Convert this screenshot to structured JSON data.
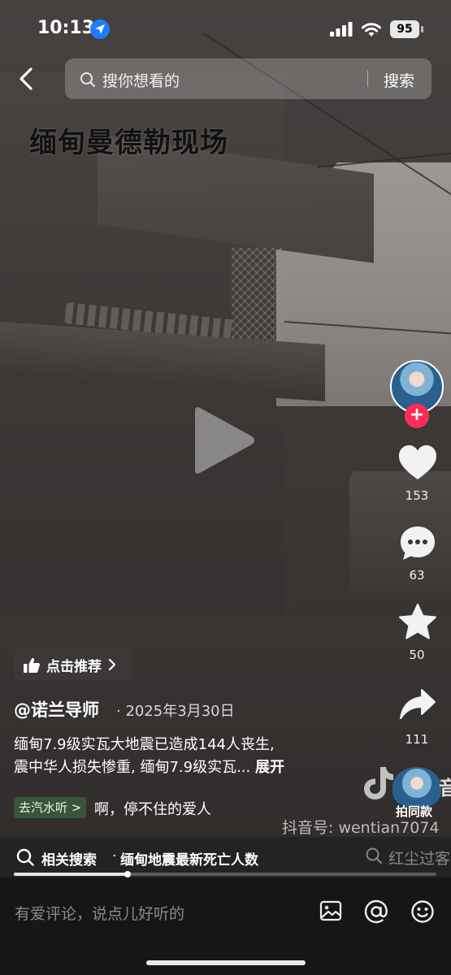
{
  "status_bar": {
    "time": "10:13",
    "battery": "95",
    "icons": [
      "location-icon",
      "signal-icon",
      "wifi-icon",
      "battery-icon"
    ]
  },
  "search": {
    "placeholder": "搜你想看的",
    "button_label": "搜索"
  },
  "video": {
    "overlay_title": "缅甸曼德勒现场",
    "state": "paused"
  },
  "actions": {
    "likes": "153",
    "comments": "63",
    "favorites": "50",
    "shares": "111"
  },
  "info": {
    "recommend_label": "点击推荐",
    "author": "@诺兰导师",
    "date": "· 2025年3月30日",
    "description_line1": "缅甸7.9级实瓦大地震已造成144人丧生,",
    "description_line2": "震中华人损失惨重, 缅甸7.9级实瓦...",
    "expand_label": "展开",
    "music_tag": "去汽水听 >",
    "music_title": "啊，停不住的爱人",
    "same_shot": "拍同款",
    "watermark_text": "音",
    "douyin_id": "抖音号: wentian7074"
  },
  "related": {
    "label": "相关搜索",
    "dot": "·",
    "query": "缅甸地震最新死亡人数",
    "right_text": "红尘过客"
  },
  "progress": {
    "fraction": 0.27
  },
  "comment": {
    "placeholder": "有爱评论，说点儿好听的"
  },
  "colors": {
    "accent": "#fe2c55",
    "location_blue": "#1e7bff"
  }
}
